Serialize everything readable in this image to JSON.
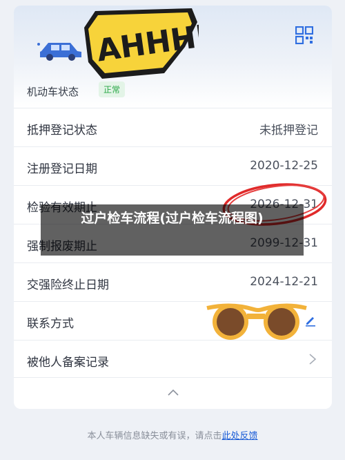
{
  "header": {
    "sticker_text": "AHHHH!",
    "qr_icon": "qr-code-icon",
    "car_icon": "car-icon"
  },
  "vehicle_status": {
    "label": "机动车状态",
    "badge": "正常",
    "badge_color": "#28a745"
  },
  "rows": [
    {
      "label": "抵押登记状态",
      "value": "未抵押登记"
    },
    {
      "label": "注册登记日期",
      "value": "2020-12-25"
    },
    {
      "label": "检验有效期止",
      "value": "2026-12-31"
    },
    {
      "label": "强制报废期止",
      "value": "2099-12-31"
    },
    {
      "label": "交强险终止日期",
      "value": "2024-12-21"
    },
    {
      "label": "联系方式",
      "value": ""
    },
    {
      "label": "被他人备案记录",
      "value": ""
    }
  ],
  "footer": {
    "text": "本人车辆信息缺失或有误，请点击",
    "link": "此处反馈"
  },
  "watermark": {
    "text": "过户检车流程(过户检车流程图)"
  }
}
